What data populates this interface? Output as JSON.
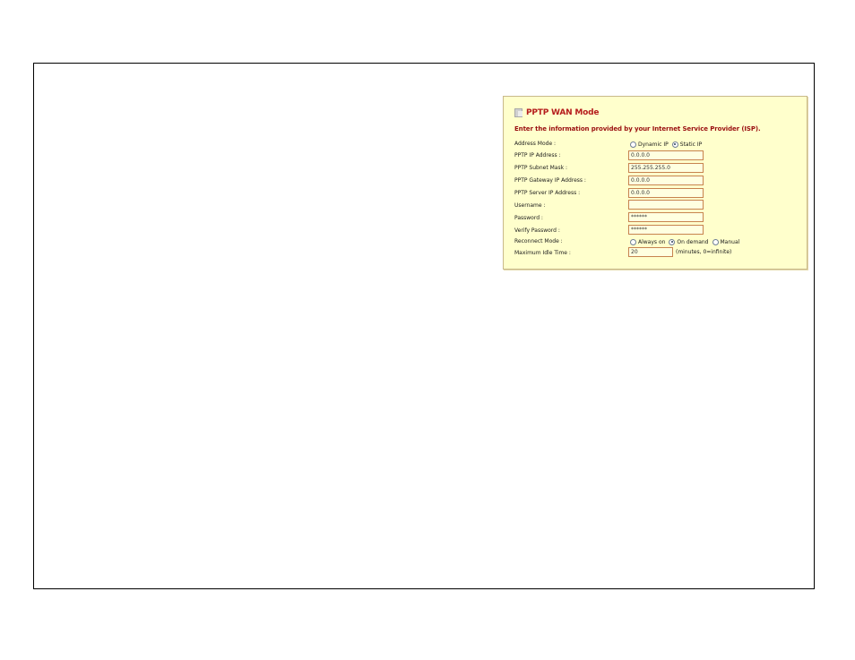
{
  "panel": {
    "title": "PPTP WAN Mode",
    "instructions": "Enter the information provided by your Internet Service Provider (ISP)."
  },
  "address_mode": {
    "label": "Address Mode :",
    "options": [
      {
        "label": "Dynamic IP",
        "checked": false
      },
      {
        "label": "Static IP",
        "checked": true
      }
    ]
  },
  "pptp_ip": {
    "label": "PPTP IP Address :",
    "value": "0.0.0.0"
  },
  "pptp_subnet": {
    "label": "PPTP Subnet Mask :",
    "value": "255.255.255.0"
  },
  "pptp_gateway": {
    "label": "PPTP Gateway IP Address :",
    "value": "0.0.0.0"
  },
  "pptp_server": {
    "label": "PPTP Server IP Address :",
    "value": "0.0.0.0"
  },
  "username": {
    "label": "Username :",
    "value": ""
  },
  "password": {
    "label": "Password :",
    "value": "******"
  },
  "verify_password": {
    "label": "Verify Password :",
    "value": "******"
  },
  "reconnect_mode": {
    "label": "Reconnect Mode :",
    "options": [
      {
        "label": "Always on",
        "checked": false
      },
      {
        "label": "On demand",
        "checked": true
      },
      {
        "label": "Manual",
        "checked": false
      }
    ]
  },
  "max_idle": {
    "label": "Maximum Idle Time :",
    "value": "20",
    "units": "(minutes, 0=infinite)"
  },
  "colors": {
    "panel_bg": "#ffffcc",
    "title": "#b51c1c",
    "field_border": "#c7834f"
  }
}
